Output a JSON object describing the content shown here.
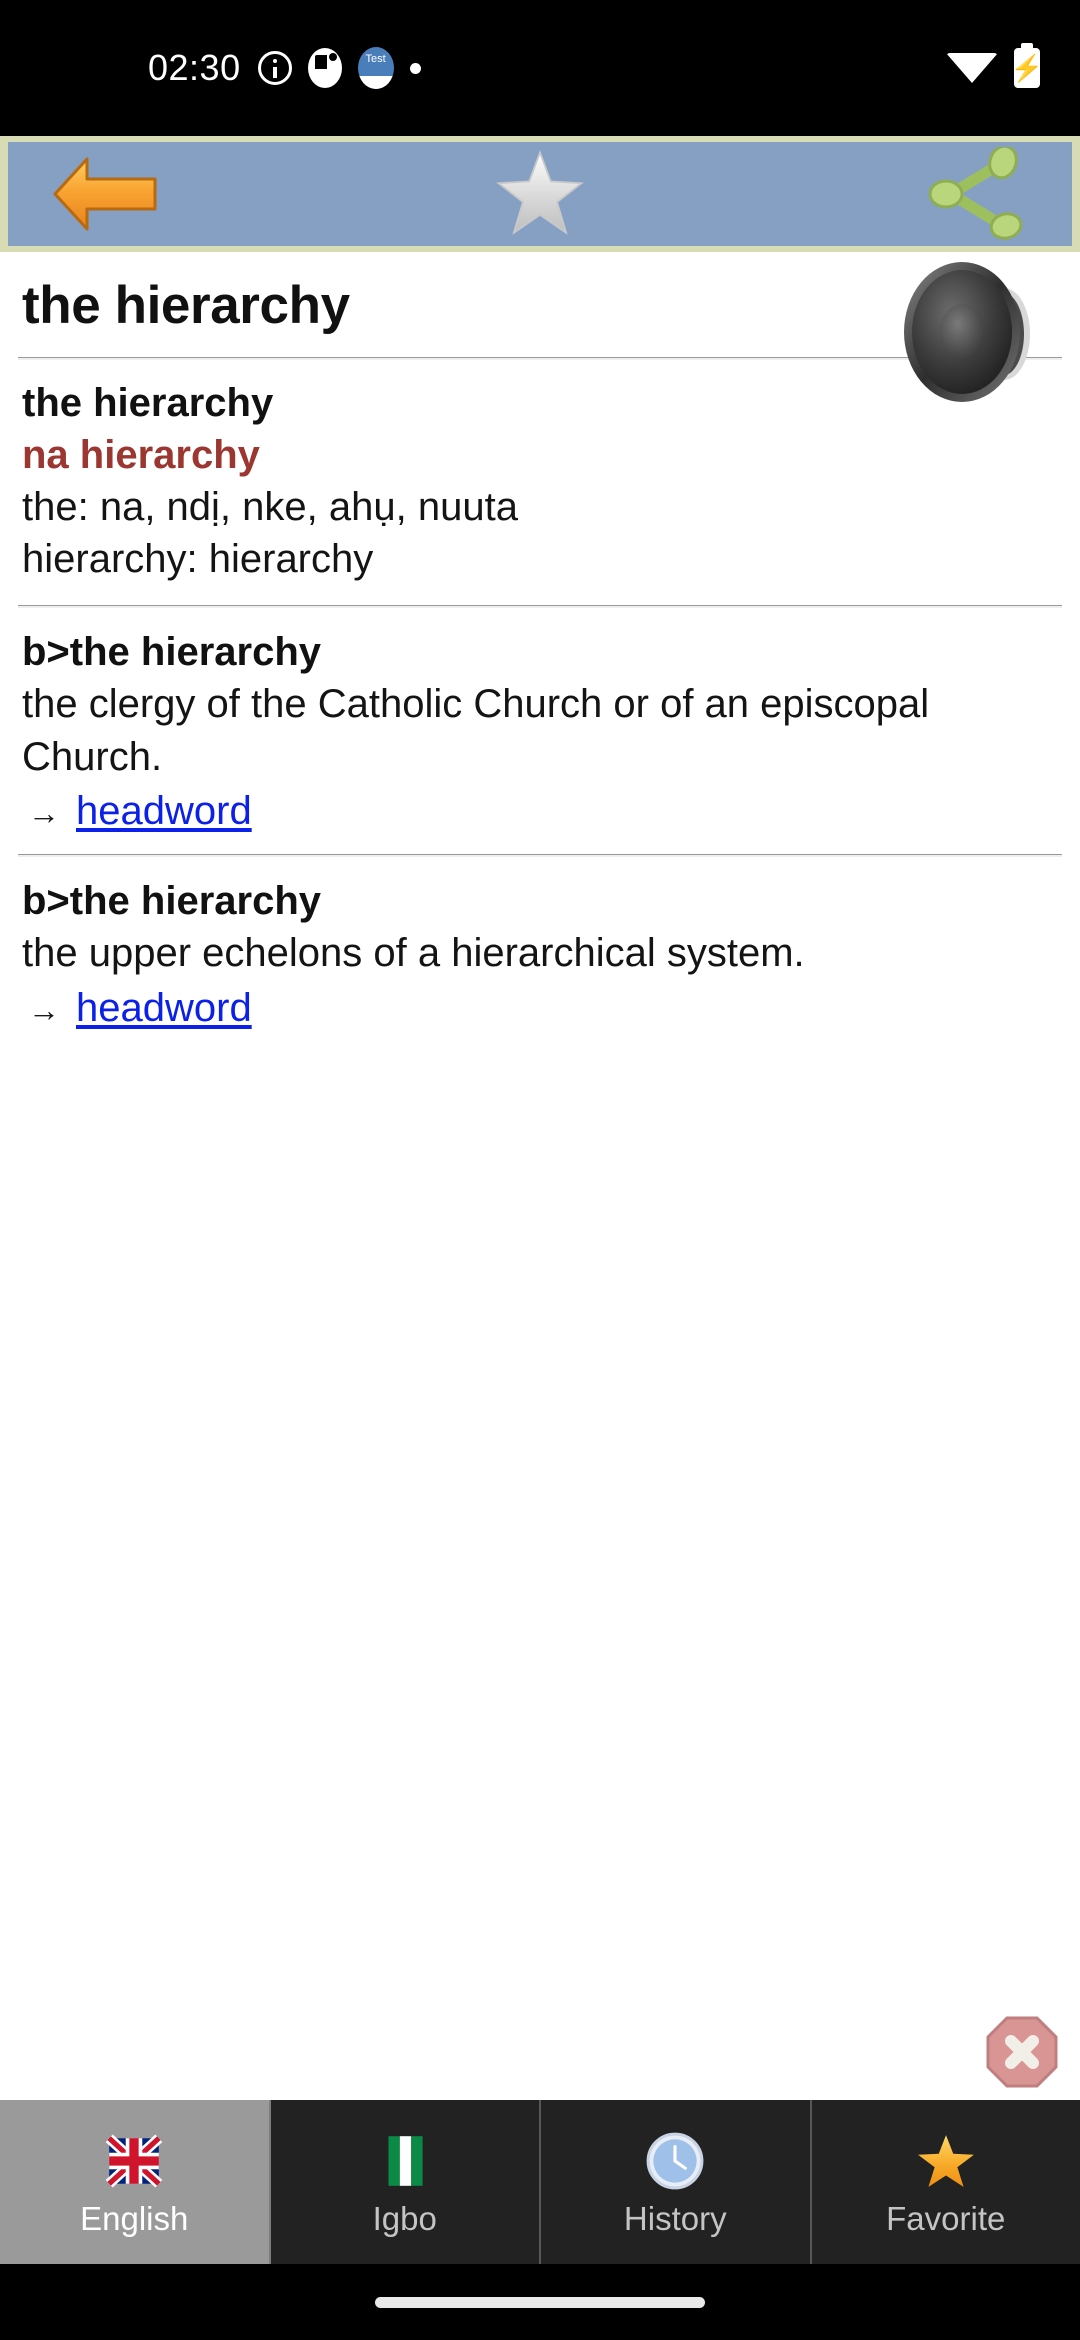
{
  "status_bar": {
    "time": "02:30",
    "icons": [
      "info-icon",
      "notification-icon",
      "test-app-icon",
      "dot-icon"
    ],
    "right_icons": [
      "wifi-icon",
      "battery-charging-icon"
    ],
    "test_badge_label": "Test"
  },
  "toolbar": {
    "back_label": "Back",
    "favorite_label": "Favorite",
    "share_label": "Share",
    "background_color": "#86a0c4",
    "border_color": "#d8dcb4"
  },
  "entry": {
    "headline": "the hierarchy",
    "speaker_label": "Pronounce",
    "term": "the hierarchy",
    "translation": "na hierarchy",
    "translation_color": "#9c3631",
    "gloss_lines": [
      "the: na, ndị, nke, ahụ, nuuta",
      "hierarchy: hierarchy"
    ]
  },
  "definitions": [
    {
      "title": "b>the hierarchy",
      "text": "the clergy of the Catholic Church or of an episcopal Church.",
      "link_arrow": "→",
      "link_label": "headword"
    },
    {
      "title": "b>the hierarchy",
      "text": "the upper echelons of a hierarchical system.",
      "link_arrow": "→",
      "link_label": "headword"
    }
  ],
  "close_button": {
    "label": "Close"
  },
  "bottom_nav": {
    "items": [
      {
        "label": "English",
        "icon": "uk-flag-icon",
        "active": true
      },
      {
        "label": "Igbo",
        "icon": "nigeria-flag-icon",
        "active": false
      },
      {
        "label": "History",
        "icon": "clock-icon",
        "active": false
      },
      {
        "label": "Favorite",
        "icon": "star-icon",
        "active": false
      }
    ]
  },
  "colors": {
    "link": "#0b20e8",
    "accent_red": "#9c3631",
    "toolbar_blue": "#86a0c4",
    "nav_active": "#9a9a9a",
    "nav_background": "#222222"
  }
}
